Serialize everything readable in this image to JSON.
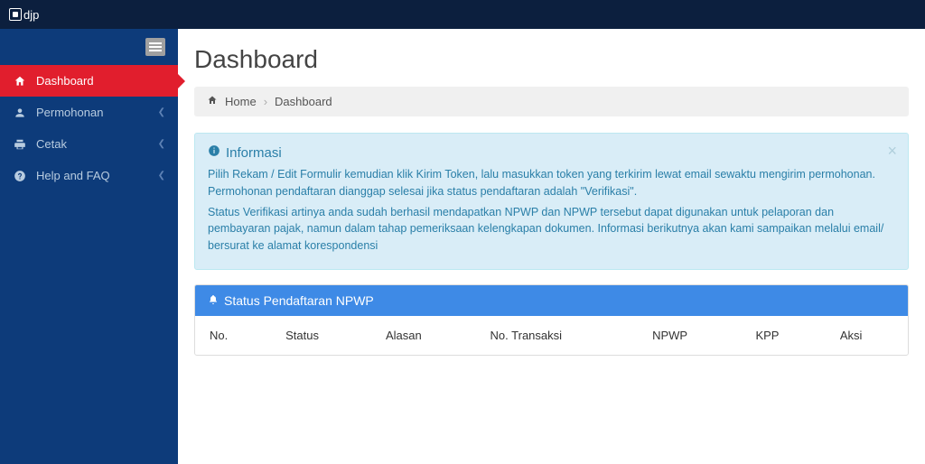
{
  "brand": {
    "name": "djp"
  },
  "sidebar": {
    "items": [
      {
        "icon": "home",
        "label": "Dashboard",
        "active": true,
        "expandable": false
      },
      {
        "icon": "user",
        "label": "Permohonan",
        "active": false,
        "expandable": true
      },
      {
        "icon": "print",
        "label": "Cetak",
        "active": false,
        "expandable": true
      },
      {
        "icon": "question",
        "label": "Help and FAQ",
        "active": false,
        "expandable": true
      }
    ]
  },
  "page": {
    "title": "Dashboard"
  },
  "breadcrumb": {
    "home_label": "Home",
    "current": "Dashboard"
  },
  "alert": {
    "title": "Informasi",
    "p1": "Pilih Rekam / Edit Formulir kemudian klik Kirim Token, lalu masukkan token yang terkirim lewat email sewaktu mengirim permohonan. Permohonan pendaftaran dianggap selesai jika status pendaftaran adalah \"Verifikasi\".",
    "p2": "Status Verifikasi artinya anda sudah berhasil mendapatkan NPWP dan NPWP tersebut dapat digunakan untuk pelaporan dan pembayaran pajak, namun dalam tahap pemeriksaan kelengkapan dokumen. Informasi berikutnya akan kami sampaikan melalui email/ bersurat ke alamat korespondensi"
  },
  "panel": {
    "title": "Status Pendaftaran NPWP",
    "columns": [
      "No.",
      "Status",
      "Alasan",
      "No. Transaksi",
      "NPWP",
      "KPP",
      "Aksi"
    ]
  }
}
